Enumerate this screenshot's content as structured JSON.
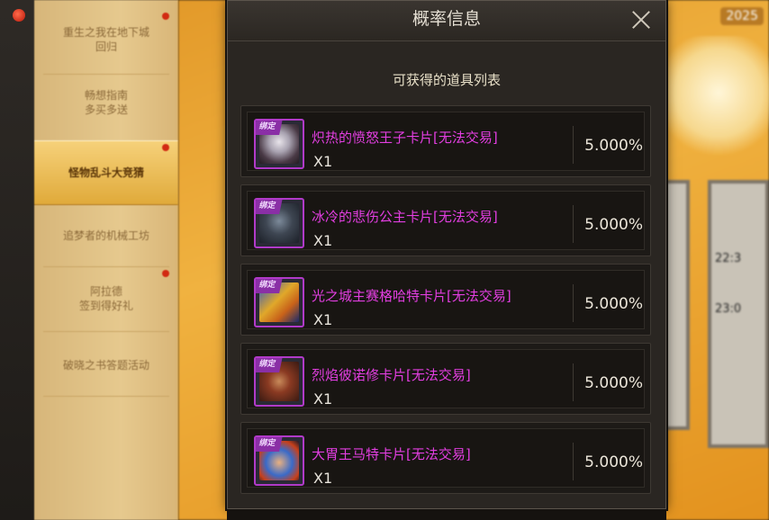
{
  "background": {
    "year_tag": "2025",
    "times": [
      "22:3",
      "23:0"
    ],
    "side_menu": [
      {
        "label": "重生之我在地下城\n回归",
        "has_dot": true
      },
      {
        "label": "畅想指南\n多买多送",
        "has_dot": false
      },
      {
        "label": "怪物乱斗大竞猜",
        "has_dot": true,
        "active": true
      },
      {
        "label": "追梦者的机械工坊",
        "has_dot": false
      },
      {
        "label": "阿拉德\n签到得好礼",
        "has_dot": true
      },
      {
        "label": "破晓之书答题活动",
        "has_dot": false
      }
    ]
  },
  "modal": {
    "title": "概率信息",
    "subheading": "可获得的道具列表",
    "items": [
      {
        "name": "炽热的愤怒王子卡片[无法交易]",
        "qty": "X1",
        "probability": "5.000%",
        "bind_tag": "绑定",
        "icon": "angry-prince-card-icon"
      },
      {
        "name": "冰冷的悲伤公主卡片[无法交易]",
        "qty": "X1",
        "probability": "5.000%",
        "bind_tag": "绑定",
        "icon": "sad-princess-card-icon"
      },
      {
        "name": "光之城主赛格哈特卡片[无法交易]",
        "qty": "X1",
        "probability": "5.000%",
        "bind_tag": "绑定",
        "icon": "seghart-card-icon"
      },
      {
        "name": "烈焰彼诺修卡片[无法交易]",
        "qty": "X1",
        "probability": "5.000%",
        "bind_tag": "绑定",
        "icon": "pinosh-card-icon"
      },
      {
        "name": "大胃王马特卡片[无法交易]",
        "qty": "X1",
        "probability": "5.000%",
        "bind_tag": "绑定",
        "icon": "matt-card-icon"
      }
    ]
  },
  "colors": {
    "item_name": "#e23ee0",
    "rarity_border": "#b13ac9"
  }
}
